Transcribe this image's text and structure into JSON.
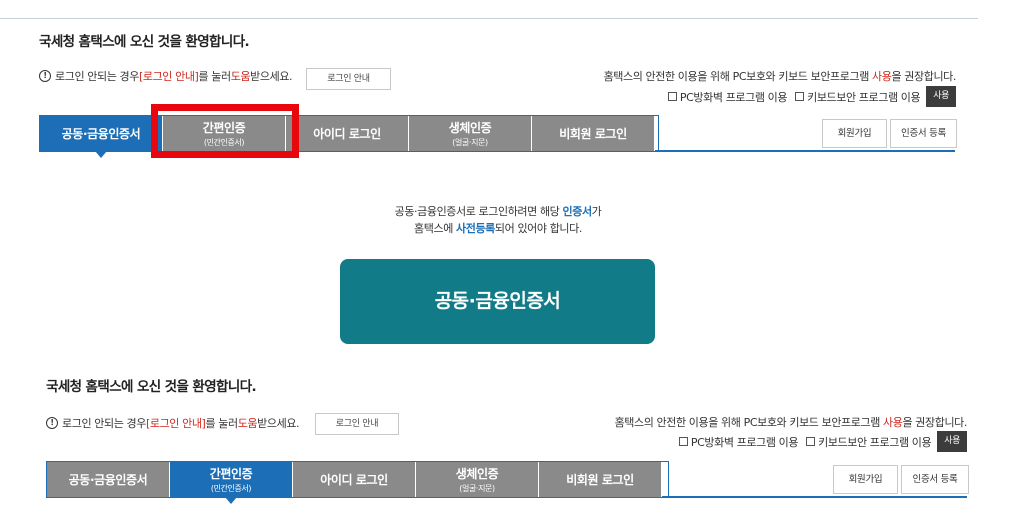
{
  "welcome": "국세청 홈택스에 오신 것을 환영합니다.",
  "notice": {
    "icon": "info-circle-icon",
    "prefix": "로그인 안되는 경우 ",
    "link": "[로그인 안내]",
    "mid": "를 눌러 ",
    "help": "도움",
    "suffix": "받으세요."
  },
  "guide_button": "로그인 안내",
  "security": {
    "prefix": "홈택스의 안전한 이용을 위해 PC보호와 키보드 보안프로그램 ",
    "use": "사용",
    "suffix": "을 권장합니다."
  },
  "checks": {
    "firewall": "PC방화벽 프로그램 이용",
    "keyboard": "키보드보안 프로그램 이용",
    "use_button": "사용"
  },
  "tabs": [
    {
      "label": "공동·금융인증서",
      "sub": ""
    },
    {
      "label": "간편인증",
      "sub": "(민간인증서)"
    },
    {
      "label": "아이디 로그인",
      "sub": ""
    },
    {
      "label": "생체인증",
      "sub": "(얼굴·지문)"
    },
    {
      "label": "비회원 로그인",
      "sub": ""
    }
  ],
  "side_buttons": {
    "join": "회원가입",
    "register_cert": "인증서 등록"
  },
  "description": {
    "line1_prefix": "공동·금융인증서로 로그인하려면 해당 ",
    "line1_highlight": "인증서",
    "line1_suffix": "가",
    "line2_prefix": "홈택스에 ",
    "line2_highlight": "사전등록",
    "line2_suffix": "되어 있어야 합니다."
  },
  "cert_button": "공동·금융인증서",
  "colors": {
    "tab_active": "#1c6fb7",
    "tab_inactive": "#8a8a8a",
    "cert_button": "#127b88",
    "highlight_box": "#e8070d",
    "warning_text": "#d0261c"
  }
}
